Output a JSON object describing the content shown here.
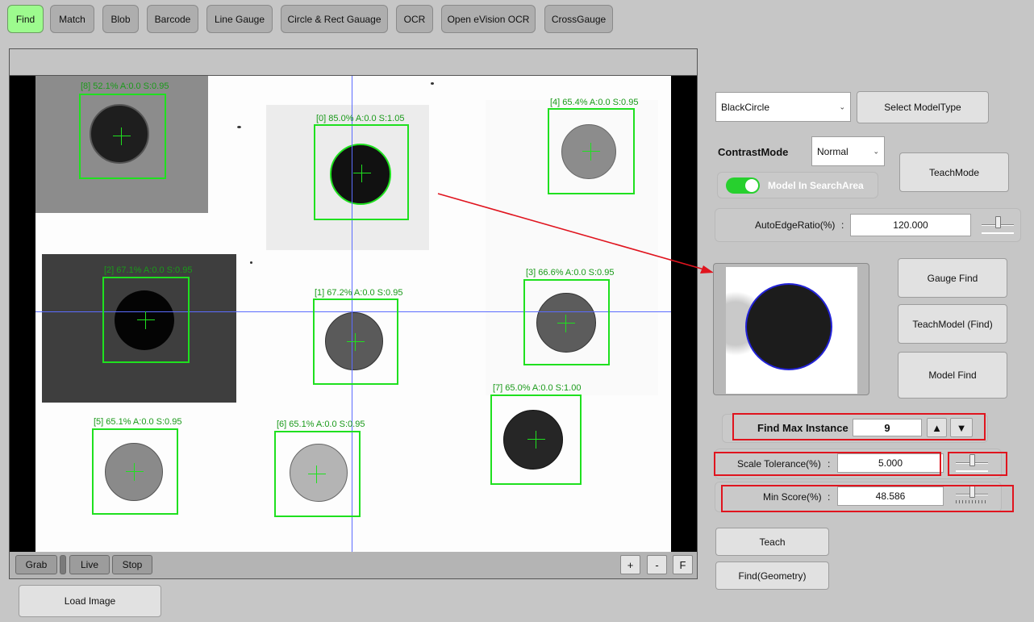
{
  "tabs": [
    {
      "label": "Find",
      "active": true
    },
    {
      "label": "Match"
    },
    {
      "label": "Blob"
    },
    {
      "label": "Barcode"
    },
    {
      "label": "Line Gauge"
    },
    {
      "label": "Circle & Rect Gauage"
    },
    {
      "label": "OCR"
    },
    {
      "label": "Open eVision OCR"
    },
    {
      "label": "CrossGauge"
    }
  ],
  "results": [
    {
      "label": "[8] 52.1% A:0.0 S:0.95"
    },
    {
      "label": "[0] 85.0% A:0.0 S:1.05"
    },
    {
      "label": "[4] 65.4% A:0.0 S:0.95"
    },
    {
      "label": "[2] 67.1% A:0.0 S:0.95"
    },
    {
      "label": "[1] 67.2% A:0.0 S:0.95"
    },
    {
      "label": "[3] 66.6% A:0.0 S:0.95"
    },
    {
      "label": "[7] 65.0% A:0.0 S:1.00"
    },
    {
      "label": "[5] 65.1% A:0.0 S:0.95"
    },
    {
      "label": "[6] 65.1% A:0.0 S:0.95"
    }
  ],
  "viewer_controls": {
    "grab": "Grab",
    "live": "Live",
    "stop": "Stop",
    "zoom_in": "+",
    "zoom_out": "-",
    "fit": "F"
  },
  "load_image": "Load Image",
  "panel": {
    "model_type": "BlackCircle",
    "select_model_type": "Select ModelType",
    "contrast_mode_label": "ContrastMode",
    "contrast_mode_value": "Normal",
    "teach_mode": "TeachMode",
    "model_in_search_area": "Model In SearchArea",
    "model_in_search_area_on": true,
    "auto_edge_ratio_label": "AutoEdgeRatio(%)",
    "auto_edge_ratio_value": "120.000",
    "gauge_find": "Gauge Find",
    "teach_model_find": "TeachModel (Find)",
    "model_find": "Model Find",
    "find_max_instance_label": "Find Max Instance",
    "find_max_instance_value": "9",
    "up_arrow": "▲",
    "down_arrow": "▼",
    "scale_tolerance_label": "Scale Tolerance(%)",
    "scale_tolerance_value": "5.000",
    "min_score_label": "Min Score(%)",
    "min_score_value": "48.586",
    "colon": ":",
    "teach": "Teach",
    "find_geometry": "Find(Geometry)"
  },
  "colors": {
    "active_tab": "#9dfb8e",
    "roi": "#1fe01f",
    "highlight": "#e0141e",
    "crosshair": "#5b6cff"
  }
}
